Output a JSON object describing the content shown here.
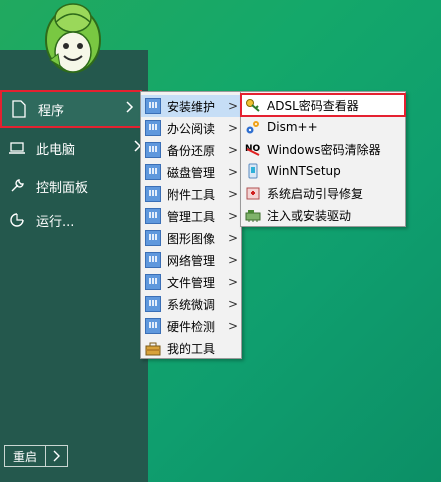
{
  "start_menu": {
    "items": [
      {
        "label": "程序",
        "icon": "page-icon",
        "has_arrow": true,
        "active": true
      },
      {
        "label": "此电脑",
        "icon": "laptop-icon",
        "has_arrow": true
      },
      {
        "label": "控制面板",
        "icon": "wrench-icon",
        "has_arrow": false
      },
      {
        "label": "运行...",
        "icon": "run-icon",
        "has_arrow": false
      }
    ],
    "restart_label": "重启",
    "restart_arrow": ">"
  },
  "submenu_programs": {
    "items": [
      {
        "label": "安装维护",
        "icon": "folder-icon",
        "arrow": ">"
      },
      {
        "label": "办公阅读",
        "icon": "folder-icon",
        "arrow": ">"
      },
      {
        "label": "备份还原",
        "icon": "folder-icon",
        "arrow": ">"
      },
      {
        "label": "磁盘管理",
        "icon": "folder-icon",
        "arrow": ">"
      },
      {
        "label": "附件工具",
        "icon": "folder-icon",
        "arrow": ">"
      },
      {
        "label": "管理工具",
        "icon": "folder-icon",
        "arrow": ">"
      },
      {
        "label": "图形图像",
        "icon": "folder-icon",
        "arrow": ">"
      },
      {
        "label": "网络管理",
        "icon": "folder-icon",
        "arrow": ">"
      },
      {
        "label": "文件管理",
        "icon": "folder-icon",
        "arrow": ">"
      },
      {
        "label": "系统微调",
        "icon": "folder-icon",
        "arrow": ">"
      },
      {
        "label": "硬件检测",
        "icon": "folder-icon",
        "arrow": ">"
      },
      {
        "label": "我的工具",
        "icon": "toolbox-icon",
        "arrow": ""
      }
    ]
  },
  "submenu_install": {
    "items": [
      {
        "label": "ADSL密码查看器",
        "icon": "key-icon"
      },
      {
        "label": "Dism++",
        "icon": "gears-icon"
      },
      {
        "label": "Windows密码清除器",
        "icon": "no-password-icon"
      },
      {
        "label": "WinNTSetup",
        "icon": "setup-icon"
      },
      {
        "label": "系统启动引导修复",
        "icon": "boot-repair-icon"
      },
      {
        "label": "注入或安装驱动",
        "icon": "driver-icon"
      }
    ]
  },
  "colors": {
    "desktop": "#14a86a",
    "start_panel": "#24584d",
    "highlight_border": "#e52130",
    "menu_bg": "#f2f2f2",
    "menu_hover": "#c6def6"
  }
}
